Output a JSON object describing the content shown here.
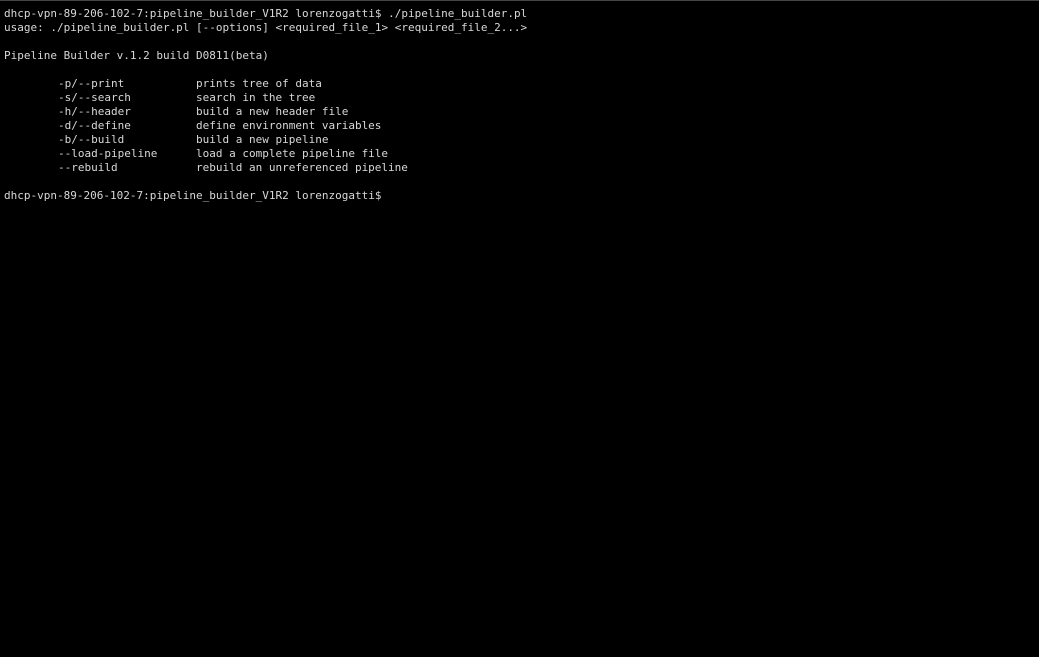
{
  "prompt1": {
    "host": "dhcp-vpn-89-206-102-7:pipeline_builder_V1R2 lorenzogatti$ ",
    "command": "./pipeline_builder.pl"
  },
  "usage": "usage: ./pipeline_builder.pl [--options] <required_file_1> <required_file_2...>",
  "version": "Pipeline Builder v.1.2 build D0811(beta)",
  "options": [
    {
      "flag": "-p/--print",
      "desc": "prints tree of data"
    },
    {
      "flag": "-s/--search",
      "desc": "search in the tree"
    },
    {
      "flag": "-h/--header",
      "desc": "build a new header file"
    },
    {
      "flag": "-d/--define",
      "desc": "define environment variables"
    },
    {
      "flag": "-b/--build",
      "desc": "build a new pipeline"
    },
    {
      "flag": "--load-pipeline",
      "desc": "load a complete pipeline file"
    },
    {
      "flag": "--rebuild",
      "desc": "rebuild an unreferenced pipeline"
    }
  ],
  "prompt2": {
    "host": "dhcp-vpn-89-206-102-7:pipeline_builder_V1R2 lorenzogatti$ "
  }
}
